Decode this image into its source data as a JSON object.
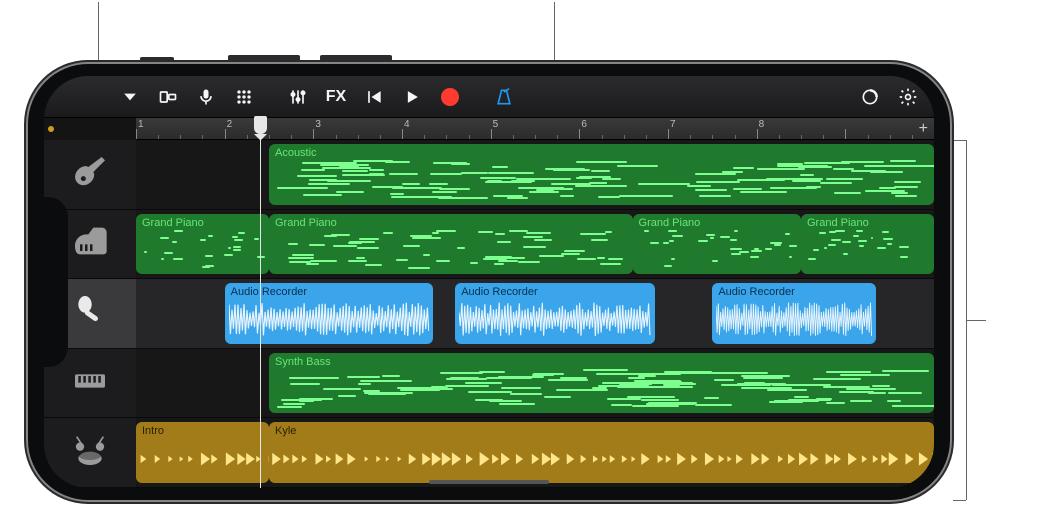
{
  "toolbar": {
    "view_menu_icon": "chevron-down-icon",
    "browser_icon": "browser-icon",
    "mic_icon": "microphone-icon",
    "grid_icon": "grid-icon",
    "mixer_icon": "mixer-icon",
    "fx_label": "FX",
    "rewind_icon": "rewind-icon",
    "play_icon": "play-icon",
    "record_icon": "record-icon",
    "metronome_icon": "metronome-icon",
    "loop_icon": "loop-browser-icon",
    "settings_icon": "settings-icon"
  },
  "ruler": {
    "bar_count": 9,
    "bar_labels": [
      "1",
      "2",
      "3",
      "4",
      "5",
      "6",
      "7",
      "8"
    ],
    "playhead_bar": 1.4,
    "add_label": "+"
  },
  "tracks": [
    {
      "id": "acoustic-guitar",
      "icon": "guitar-icon",
      "selected": false,
      "solo": false,
      "regions": [
        {
          "label": "Acoustic",
          "start": 1.5,
          "end": 9.0,
          "kind": "midi",
          "color": "green"
        }
      ]
    },
    {
      "id": "grand-piano",
      "icon": "piano-icon",
      "selected": false,
      "solo": true,
      "regions": [
        {
          "label": "Grand Piano",
          "start": 0.0,
          "end": 1.5,
          "kind": "midi",
          "color": "green"
        },
        {
          "label": "Grand Piano",
          "start": 1.5,
          "end": 5.6,
          "kind": "midi",
          "color": "green"
        },
        {
          "label": "Grand Piano",
          "start": 5.6,
          "end": 7.5,
          "kind": "midi",
          "color": "green"
        },
        {
          "label": "Grand Piano",
          "start": 7.5,
          "end": 9.0,
          "kind": "midi",
          "color": "green"
        }
      ]
    },
    {
      "id": "audio-recorder",
      "icon": "mic-track-icon",
      "selected": true,
      "solo": false,
      "regions": [
        {
          "label": "Audio Recorder",
          "start": 1.0,
          "end": 3.35,
          "kind": "audio",
          "color": "blue"
        },
        {
          "label": "Audio Recorder",
          "start": 3.6,
          "end": 5.85,
          "kind": "audio",
          "color": "blue"
        },
        {
          "label": "Audio Recorder",
          "start": 6.5,
          "end": 8.35,
          "kind": "audio",
          "color": "blue"
        }
      ]
    },
    {
      "id": "synth-bass",
      "icon": "keyboard-icon",
      "selected": false,
      "solo": false,
      "regions": [
        {
          "label": "Synth Bass",
          "start": 1.5,
          "end": 9.0,
          "kind": "midi",
          "color": "green"
        }
      ]
    },
    {
      "id": "drummer",
      "icon": "drums-icon",
      "selected": false,
      "solo": false,
      "regions": [
        {
          "label": "Intro",
          "start": 0.0,
          "end": 1.5,
          "kind": "drummer",
          "color": "yellow"
        },
        {
          "label": "Kyle",
          "start": 1.5,
          "end": 9.0,
          "kind": "drummer",
          "color": "yellow"
        }
      ]
    }
  ],
  "colors": {
    "midi_green": "#1f7a2d",
    "midi_note": "#7dff8f",
    "audio_blue": "#3aa5ea",
    "drummer_yellow": "#a17c18",
    "accent_blue": "#1d9bf0",
    "record_red": "#ff3b30"
  }
}
